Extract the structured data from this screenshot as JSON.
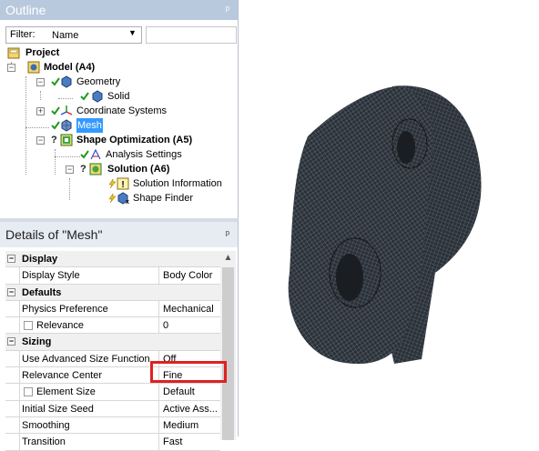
{
  "outline": {
    "title": "Outline",
    "filter_label": "Filter:",
    "filter_value": "Name",
    "tree": {
      "project": "Project",
      "model": "Model (A4)",
      "geometry": "Geometry",
      "solid": "Solid",
      "coordinate_systems": "Coordinate Systems",
      "mesh": "Mesh",
      "shape_optimization": "Shape Optimization (A5)",
      "analysis_settings": "Analysis Settings",
      "solution": "Solution (A6)",
      "solution_information": "Solution Information",
      "shape_finder": "Shape Finder"
    }
  },
  "details": {
    "title": "Details of \"Mesh\"",
    "groups": {
      "display": "Display",
      "defaults": "Defaults",
      "sizing": "Sizing"
    },
    "rows": {
      "display_style": {
        "label": "Display Style",
        "value": "Body Color"
      },
      "physics_preference": {
        "label": "Physics Preference",
        "value": "Mechanical"
      },
      "relevance": {
        "label": "Relevance",
        "value": "0"
      },
      "use_advanced_size_function": {
        "label": "Use Advanced Size Function",
        "value": "Off"
      },
      "relevance_center": {
        "label": "Relevance Center",
        "value": "Fine"
      },
      "element_size": {
        "label": "Element Size",
        "value": "Default"
      },
      "initial_size_seed": {
        "label": "Initial Size Seed",
        "value": "Active Ass..."
      },
      "smoothing": {
        "label": "Smoothing",
        "value": "Medium"
      },
      "transition": {
        "label": "Transition",
        "value": "Fast"
      }
    },
    "highlight_color": "#e02020"
  },
  "viewport": {
    "mesh_color": "#2b3138",
    "icon": "meshed-part-icon"
  }
}
